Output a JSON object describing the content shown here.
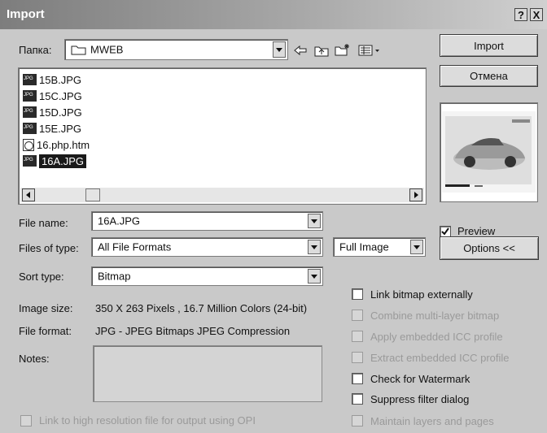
{
  "window": {
    "title": "Import",
    "help_button": "?",
    "close_button": "X"
  },
  "folder": {
    "label": "Папка:",
    "value": "MWEB"
  },
  "files": [
    {
      "name": "15B.JPG",
      "type": "jpg",
      "selected": false
    },
    {
      "name": "15C.JPG",
      "type": "jpg",
      "selected": false
    },
    {
      "name": "15D.JPG",
      "type": "jpg",
      "selected": false
    },
    {
      "name": "15E.JPG",
      "type": "jpg",
      "selected": false
    },
    {
      "name": "16.php.htm",
      "type": "htm",
      "selected": false
    },
    {
      "name": "16A.JPG",
      "type": "jpg",
      "selected": true
    }
  ],
  "buttons": {
    "import": "Import",
    "cancel": "Отмена",
    "options": "Options <<"
  },
  "preview": {
    "label": "Preview",
    "checked": true
  },
  "form": {
    "file_name_label": "File name:",
    "file_name_value": "16A.JPG",
    "file_type_label": "Files of type:",
    "file_type_value": "All File Formats",
    "image_mode_value": "Full Image",
    "sort_type_label": "Sort type:",
    "sort_type_value": "Bitmap",
    "image_size_label": "Image size:",
    "image_size_value": "350 X 263 Pixels , 16.7 Million Colors (24-bit)",
    "file_format_label": "File format:",
    "file_format_value": "JPG - JPEG Bitmaps JPEG Compression",
    "notes_label": "Notes:"
  },
  "options": [
    {
      "label": "Link bitmap externally",
      "enabled": true
    },
    {
      "label": "Combine multi-layer bitmap",
      "enabled": false
    },
    {
      "label": "Apply embedded ICC profile",
      "enabled": false
    },
    {
      "label": "Extract embedded ICC profile",
      "enabled": false
    },
    {
      "label": "Check for Watermark",
      "enabled": true
    },
    {
      "label": "Suppress filter dialog",
      "enabled": true
    },
    {
      "label": "Maintain layers and pages",
      "enabled": false
    }
  ],
  "opi_link": {
    "label": "Link to high resolution file for output using OPI",
    "enabled": false
  }
}
